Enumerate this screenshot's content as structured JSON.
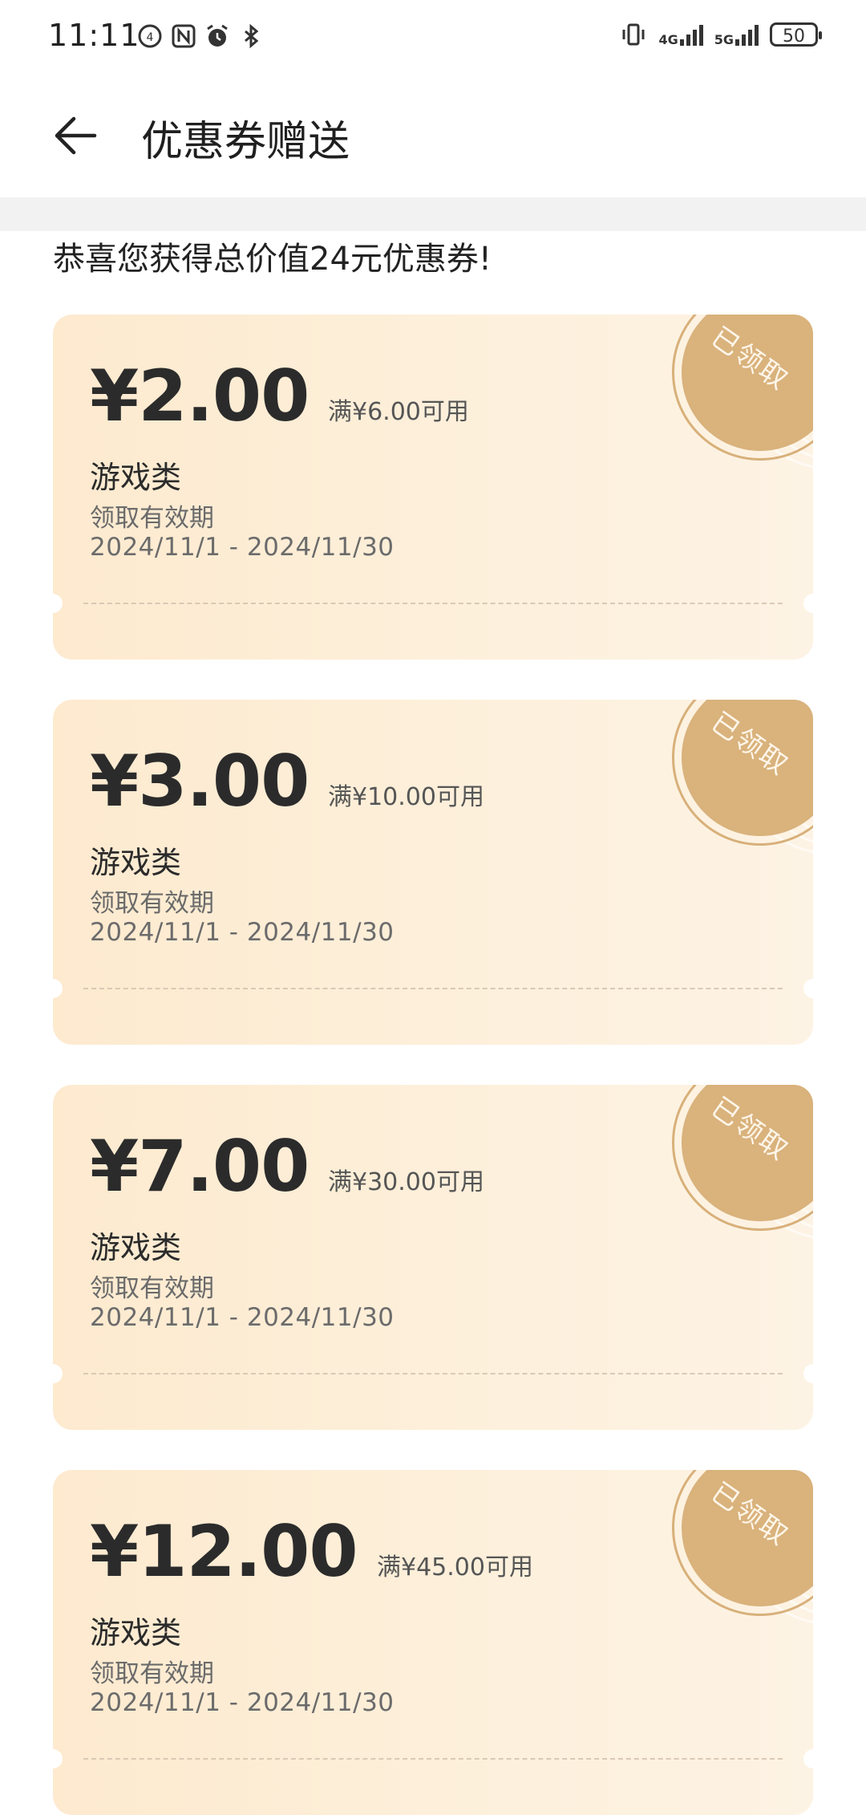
{
  "status_bar": {
    "time": "11:11",
    "battery": "50",
    "net_4g": "4G",
    "net_5g": "5G"
  },
  "header": {
    "title": "优惠券赠送"
  },
  "summary": {
    "text": "恭喜您获得总价值24元优惠券!"
  },
  "coupons": [
    {
      "amount": "¥2.00",
      "threshold": "满¥6.00可用",
      "category": "游戏类",
      "validity_label": "领取有效期",
      "validity_range": "2024/11/1 - 2024/11/30",
      "stamp": "已领取"
    },
    {
      "amount": "¥3.00",
      "threshold": "满¥10.00可用",
      "category": "游戏类",
      "validity_label": "领取有效期",
      "validity_range": "2024/11/1 - 2024/11/30",
      "stamp": "已领取"
    },
    {
      "amount": "¥7.00",
      "threshold": "满¥30.00可用",
      "category": "游戏类",
      "validity_label": "领取有效期",
      "validity_range": "2024/11/1 - 2024/11/30",
      "stamp": "已领取"
    },
    {
      "amount": "¥12.00",
      "threshold": "满¥45.00可用",
      "category": "游戏类",
      "validity_label": "领取有效期",
      "validity_range": "2024/11/1 - 2024/11/30",
      "stamp": "已领取"
    }
  ],
  "colors": {
    "card_bg": "#fdeacf",
    "stamp": "#d9b27c",
    "text_primary": "#2b2b2b",
    "text_secondary": "#6b6b6b"
  },
  "icons": [
    "back-arrow-icon",
    "nfc-icon",
    "alarm-icon",
    "bluetooth-icon",
    "vibrate-icon",
    "signal-icon",
    "battery-icon"
  ]
}
